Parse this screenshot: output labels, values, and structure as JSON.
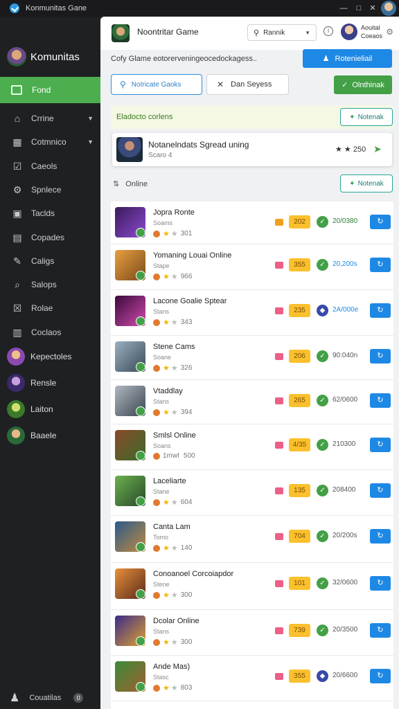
{
  "window": {
    "title": "Konmunitas Gane"
  },
  "sidebar": {
    "brand": "Komunitas",
    "active": "Fond",
    "items": [
      {
        "label": "Crrine",
        "icon": "home-icon",
        "chevron": true
      },
      {
        "label": "Cotmnico",
        "icon": "grid-icon",
        "chevron": true
      },
      {
        "label": "Caeols",
        "icon": "check-icon"
      },
      {
        "label": "Spnlece",
        "icon": "gear-icon"
      },
      {
        "label": "Taclds",
        "icon": "bookmark-icon"
      },
      {
        "label": "Copades",
        "icon": "folder-icon"
      },
      {
        "label": "Caligs",
        "icon": "feather-icon"
      },
      {
        "label": "Salops",
        "icon": "search-icon"
      },
      {
        "label": "Rolae",
        "icon": "checkbox-icon"
      },
      {
        "label": "Coclaos",
        "icon": "list-icon"
      }
    ],
    "games": [
      {
        "label": "Kepectoles"
      },
      {
        "label": "Rensle"
      },
      {
        "label": "Laiton"
      },
      {
        "label": "Baaele"
      }
    ],
    "footer": {
      "label": "Couatilas",
      "badge": "0"
    }
  },
  "header": {
    "title": "Noontritar Game",
    "select_label": "Rannik",
    "user_name": "Aouital",
    "user_sub": "Coeaos"
  },
  "subtitle": "Cofy Glame eotorerveningeocedockagess..",
  "cta_label": "Rotenieliail",
  "search": {
    "value": "Notricate Gaoks"
  },
  "filter_label": "Dan Seyess",
  "green_button": "Olnthinak",
  "banner": {
    "text": "Eladocto corlens",
    "button": "Notenak"
  },
  "featured": {
    "name": "Notanelndats Sgread uning",
    "sub": "Scaro 4",
    "rating": "250"
  },
  "online": {
    "label": "Online",
    "button": "Notenak"
  },
  "rows": [
    {
      "name": "Jopra Ronte",
      "sub": "Soams",
      "rating": "301",
      "level": "202",
      "number": "20/0380",
      "tag_color": "orange",
      "status": "green",
      "num_color": "green"
    },
    {
      "name": "Yomaning Louai Online",
      "sub": "Stape",
      "rating": "966",
      "level": "355",
      "number": "20,200s",
      "tag_color": "pink",
      "status": "green",
      "num_color": "blue"
    },
    {
      "name": "Lacone Goalie Sptear",
      "sub": "Stans",
      "rating": "343",
      "level": "235",
      "number": "2A/000e",
      "tag_color": "pink",
      "status": "blue",
      "num_color": "blue"
    },
    {
      "name": "Stene Cams",
      "sub": "Soane",
      "rating": "326",
      "level": "206",
      "number": "90:040n",
      "tag_color": "pink",
      "status": "green",
      "num_color": "gray"
    },
    {
      "name": "Vtaddlay",
      "sub": "Stans",
      "rating": "394",
      "level": "265",
      "number": "62/0600",
      "tag_color": "pink",
      "status": "green",
      "num_color": "gray"
    },
    {
      "name": "Smlsl Online",
      "sub": "Soans",
      "rating": "500",
      "prefix": "1mwt",
      "level": "4/35",
      "number": "210300",
      "tag_color": "pink",
      "status": "green",
      "num_color": "gray"
    },
    {
      "name": "Laceliarte",
      "sub": "Stane",
      "rating": "604",
      "level": "135",
      "number": "208400",
      "tag_color": "pink",
      "status": "green",
      "num_color": "gray"
    },
    {
      "name": "Canta Lam",
      "sub": "Tomo",
      "rating": "140",
      "level": "704",
      "number": "20/200s",
      "tag_color": "pink",
      "status": "green",
      "num_color": "gray"
    },
    {
      "name": "Conoanoel Corcoiapdor",
      "sub": "Stene",
      "rating": "300",
      "level": "101",
      "number": "32/0600",
      "tag_color": "pink",
      "status": "green",
      "num_color": "gray"
    },
    {
      "name": "Dcolar Online",
      "sub": "Stans",
      "rating": "300",
      "level": "739",
      "number": "20/3500",
      "tag_color": "pink",
      "status": "green",
      "num_color": "gray"
    },
    {
      "name": "Ande Mas)",
      "sub": "Stasc",
      "rating": "803",
      "level": "355",
      "number": "20/6600",
      "tag_color": "pink",
      "status": "blue",
      "num_color": "gray"
    }
  ],
  "colors": {
    "accent": "#1e88e5",
    "green": "#43a047",
    "sidebar": "#1f2022",
    "level": "#fbc02d"
  }
}
